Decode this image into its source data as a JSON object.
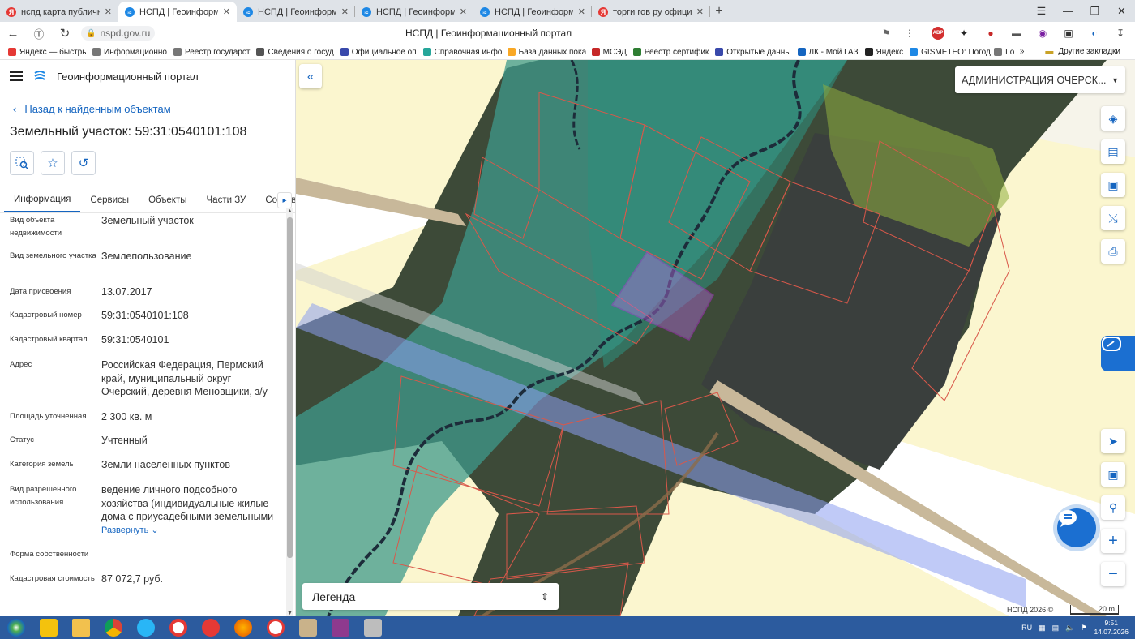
{
  "browser": {
    "tabs": [
      {
        "label": "нспд карта публичная кар",
        "icon": "yandex-icon",
        "color": "#e53935",
        "active": false
      },
      {
        "label": "НСПД | Геоинформацио",
        "icon": "nspd-icon",
        "color": "#1e88e5",
        "active": true
      },
      {
        "label": "НСПД | Геоинформацион",
        "icon": "nspd-icon",
        "color": "#1e88e5",
        "active": false
      },
      {
        "label": "НСПД | Геоинформацион",
        "icon": "nspd-icon",
        "color": "#1e88e5",
        "active": false
      },
      {
        "label": "НСПД | Геоинформацион",
        "icon": "nspd-icon",
        "color": "#1e88e5",
        "active": false
      },
      {
        "label": "торги гов ру официальны",
        "icon": "yandex-icon",
        "color": "#e53935",
        "active": false
      }
    ],
    "url": "nspd.gov.ru",
    "page_title": "НСПД | Геоинформационный портал",
    "bookmarks": [
      {
        "label": "Яндекс — быстрь",
        "color": "#e53935"
      },
      {
        "label": "Информационно",
        "color": "#777"
      },
      {
        "label": "Реестр государст",
        "color": "#777"
      },
      {
        "label": "Сведения о госуд",
        "color": "#555"
      },
      {
        "label": "Официальное оп",
        "color": "#3949ab"
      },
      {
        "label": "Справочная инфо",
        "color": "#26a69a"
      },
      {
        "label": "База данных пока",
        "color": "#f9a825"
      },
      {
        "label": "МСЭД",
        "color": "#c62828"
      },
      {
        "label": "Реестр сертифик",
        "color": "#2e7d32"
      },
      {
        "label": "Открытые данны",
        "color": "#3949ab"
      },
      {
        "label": "ЛК - Мой ГАЗ",
        "color": "#1565c0"
      },
      {
        "label": "Яндекс",
        "color": "#222"
      },
      {
        "label": "GISMETEO: Погод",
        "color": "#1e88e5"
      },
      {
        "label": "Lo",
        "color": "#777"
      }
    ],
    "bookmarks_more": "»",
    "other_bookmarks": "Другие закладки"
  },
  "panel": {
    "app_title": "Геоинформационный портал",
    "back_link": "Назад к найденным объектам",
    "object_title": "Земельный участок: 59:31:0540101:108",
    "tabs": [
      "Информация",
      "Сервисы",
      "Объекты",
      "Части ЗУ",
      "Состав"
    ],
    "properties": [
      {
        "label": "Вид объекта недвижимости",
        "value": "Земельный участок"
      },
      {
        "label": "Вид земельного участка",
        "value": "Землепользование"
      },
      {
        "label": "Дата присвоения",
        "value": "13.07.2017"
      },
      {
        "label": "Кадастровый номер",
        "value": "59:31:0540101:108"
      },
      {
        "label": "Кадастровый квартал",
        "value": "59:31:0540101"
      },
      {
        "label": "Адрес",
        "value": "Российская Федерация, Пермский край, муниципальный округ Очерский, деревня Меновщики, з/у"
      },
      {
        "label": "Площадь уточненная",
        "value": "2 300 кв. м"
      },
      {
        "label": "Статус",
        "value": "Учтенный"
      },
      {
        "label": "Категория земель",
        "value": "Земли населенных пунктов"
      },
      {
        "label": "Вид разрешенного использования",
        "value": "ведение личного подсобного хозяйства (индивидуальные жилые дома с приусадебными земельными"
      },
      {
        "label": "Форма собственности",
        "value": "-"
      },
      {
        "label": "Кадастровая стоимость",
        "value": "87 072,7 руб."
      }
    ],
    "expand_label": "Развернуть"
  },
  "map": {
    "region": "АДМИНИСТРАЦИЯ ОЧЕРСК...",
    "legend": "Легенда",
    "attribution": "НСПД 2026 ©",
    "scale": "20 m",
    "accent": "#1b6fd1"
  },
  "taskbar": {
    "lang": "RU",
    "time": "9:51",
    "date": "14.07.2026"
  }
}
